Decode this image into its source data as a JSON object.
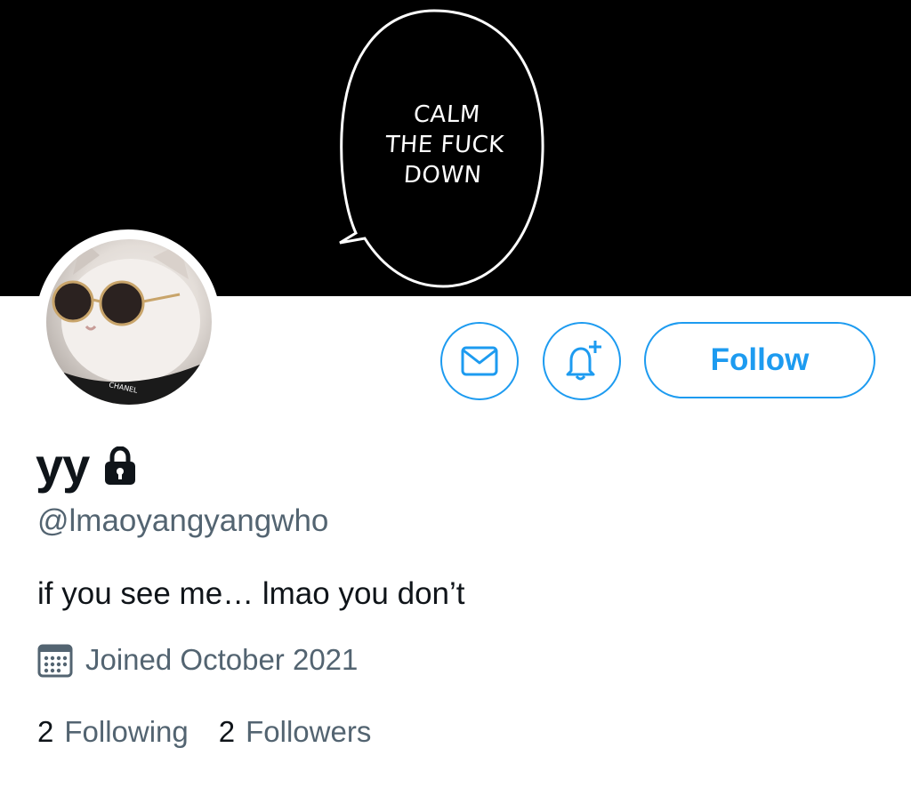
{
  "banner": {
    "speech_bubble_lines": [
      "CALM",
      "THE FUCK",
      "DOWN"
    ],
    "background_color": "#000000"
  },
  "avatar": {
    "description_icon": "cat-with-sunglasses-avatar",
    "collar_text": "CHANEL"
  },
  "actions": {
    "message_icon": "envelope-icon",
    "notify_icon": "bell-plus-icon",
    "follow_label": "Follow"
  },
  "profile": {
    "display_name": "yy",
    "protected_icon": "lock-icon",
    "handle": "@lmaoyangyangwho",
    "bio": "if you see me… lmao you don’t",
    "joined_icon": "calendar-icon",
    "joined": "Joined October 2021"
  },
  "stats": {
    "following_count": "2",
    "following_label": "Following",
    "followers_count": "2",
    "followers_label": "Followers"
  },
  "colors": {
    "accent": "#1d9bf0",
    "text_primary": "#0f1419",
    "text_secondary": "#536471"
  }
}
